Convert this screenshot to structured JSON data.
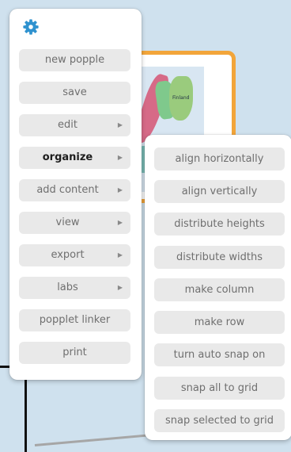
{
  "popple": {
    "map_label": "Finland"
  },
  "menu": {
    "items": [
      {
        "label": "new popple"
      },
      {
        "label": "save"
      },
      {
        "label": "edit",
        "chevron": "▶"
      },
      {
        "label": "organize",
        "chevron": "▶",
        "selected": true
      },
      {
        "label": "add content",
        "chevron": "▶"
      },
      {
        "label": "view",
        "chevron": "▶"
      },
      {
        "label": "export",
        "chevron": "▶"
      },
      {
        "label": "labs",
        "chevron": "▶"
      },
      {
        "label": "popplet linker"
      },
      {
        "label": "print"
      }
    ]
  },
  "submenu": {
    "items": [
      {
        "label": "align horizontally"
      },
      {
        "label": "align vertically"
      },
      {
        "label": "distribute heights"
      },
      {
        "label": "distribute widths"
      },
      {
        "label": "make column"
      },
      {
        "label": "make row"
      },
      {
        "label": "turn auto snap on"
      },
      {
        "label": "snap all to grid"
      },
      {
        "label": "snap selected to grid"
      }
    ]
  },
  "colors": {
    "accent": "#2f92cf",
    "frame_border": "#f2a53a",
    "canvas_background": "#cfe1ee",
    "item_background": "#e9e9e9"
  },
  "icons": {
    "settings": "gear-icon",
    "submenu_arrow": "chevron-right-icon"
  }
}
